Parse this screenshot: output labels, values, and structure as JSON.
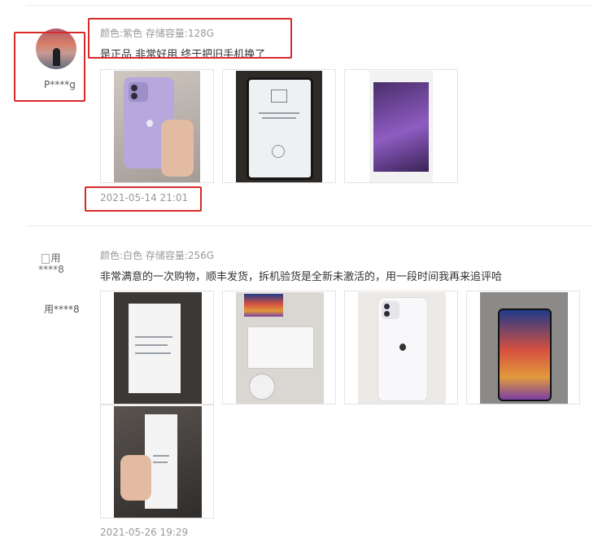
{
  "reviews": [
    {
      "username": "P****g",
      "spec": "颜色:紫色 存储容量:128G",
      "text": "是正品 非常好用 终于把旧手机换了",
      "date": "2021-05-14 21:01",
      "photos": [
        "purple-iphone-in-hand",
        "iphone-setup-screen",
        "purple-iphone-box"
      ]
    },
    {
      "avatar_alt": "用****8",
      "username": "用****8",
      "spec": "颜色:白色 存储容量:256G",
      "text": "非常满意的一次购物，顺丰发货，拆机验货是全新未激活的，用一段时间我再来追评哈",
      "date": "2021-05-26 19:29",
      "photos": [
        "white-iphone-box-back",
        "open-box-accessories",
        "white-iphone-back",
        "iphone-home-screen",
        "box-in-hand"
      ]
    }
  ],
  "highlight_color": "#d72a2a"
}
